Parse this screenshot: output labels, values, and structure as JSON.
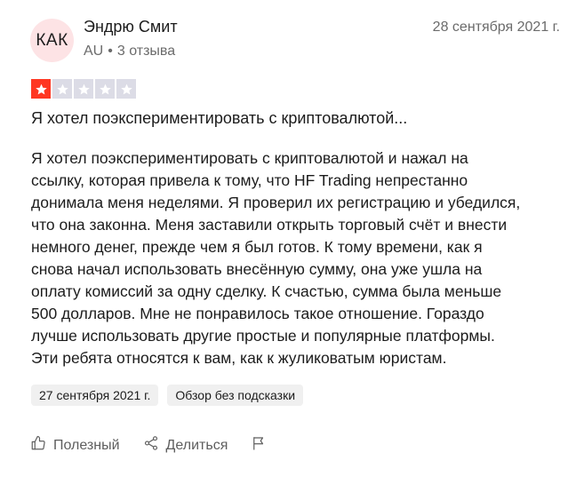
{
  "reviewer": {
    "initials": "КАК",
    "name": "Эндрю Смит",
    "country": "AU",
    "separator": "•",
    "reviews_count": "3 отзыва"
  },
  "review": {
    "date": "28 сентября 2021 г.",
    "rating": 1,
    "max_rating": 5,
    "title": "Я хотел поэкспериментировать с криптовалютой...",
    "body_lines": [
      "Я хотел поэкспериментировать с криптовалютой и нажал на",
      "ссылку, которая привела к тому, что HF Trading непрестанно",
      "донимала меня неделями. Я проверил их регистрацию и убедился,",
      "что она законна. Меня заставили открыть торговый счёт и внести",
      "немного денег, прежде чем я был готов. К тому времени, как я",
      "снова начал использовать внесённую сумму, она уже ушла на",
      "оплату комиссий за одну сделку. К счастью, сумма была меньше",
      "500 долларов. Мне не понравилось такое отношение. Гораздо",
      "лучше использовать другие простые и популярные платформы.",
      "Эти ребята относятся к вам, как к жуликоватым юристам."
    ],
    "experience_date": "27 сентября 2021 г.",
    "review_type": "Обзор без подсказки"
  },
  "actions": {
    "useful_label": "Полезный",
    "share_label": "Делиться"
  },
  "colors": {
    "star_filled": "#ff3722",
    "star_empty": "#dcdce6",
    "avatar_bg": "#fde3e5"
  },
  "icons": [
    "star-icon",
    "thumbs-up-icon",
    "share-icon",
    "flag-icon"
  ]
}
